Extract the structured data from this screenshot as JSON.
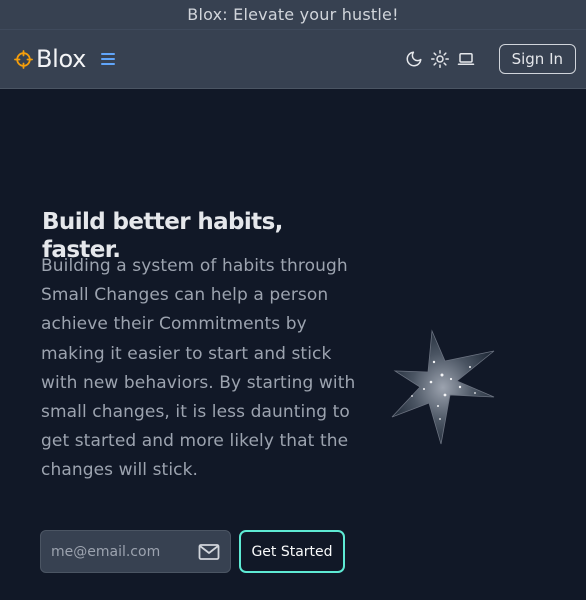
{
  "announcement": {
    "text": "Blox: Elevate your hustle!"
  },
  "navbar": {
    "brand": "Blox",
    "brand_icon": "crosshair-icon",
    "menu_icon": "hamburger-menu-icon",
    "theme_icons": [
      "moon-icon",
      "sun-icon",
      "laptop-icon"
    ],
    "sign_in_label": "Sign In"
  },
  "hero": {
    "title": "Build better habits, faster.",
    "body": "Building a system of habits through Small Changes can help a person achieve their Commitments by making it easier to start and stick with new behaviors. By starting with small changes, it is less daunting to get started and more likely that the changes will stick.",
    "email_placeholder": "me@email.com",
    "email_value": "",
    "mail_icon": "envelope-icon",
    "cta_label": "Get Started",
    "graphic": "sparkle-star-graphic"
  },
  "colors": {
    "background": "#111827",
    "navbar": "#374151",
    "brand_accent": "#f59e0b",
    "menu_accent": "#3b82f6",
    "cta_border": "#5eead4"
  }
}
